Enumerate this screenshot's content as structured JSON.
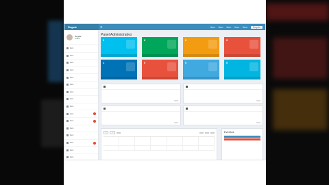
{
  "colors": {
    "topbar": "#3c8dbc",
    "aqua": "#00c0ef",
    "green": "#00a65a",
    "yellow": "#f39c12",
    "red": "#dd4b39",
    "blue": "#0073b7",
    "orange_red": "#e8523d",
    "light_blue": "#3fa9e0",
    "cyan": "#00b5e2"
  },
  "topbar": {
    "brand": "Regale",
    "menu_icon": "hamburger-icon",
    "nav": [
      "Item",
      "Item",
      "Item",
      "Item",
      "Item"
    ],
    "user": "Regale"
  },
  "sidebar": {
    "profile_name": "Regale",
    "profile_status": "Online",
    "items": [
      {
        "label": "Item",
        "badge": false
      },
      {
        "label": "Item",
        "badge": false
      },
      {
        "label": "Item",
        "badge": false
      },
      {
        "label": "Item",
        "badge": false
      },
      {
        "label": "Item",
        "badge": false
      },
      {
        "label": "Item",
        "badge": false
      },
      {
        "label": "Item",
        "badge": false
      },
      {
        "label": "Item",
        "badge": false
      },
      {
        "label": "Item",
        "badge": false
      },
      {
        "label": "Item",
        "badge": true
      },
      {
        "label": "Item",
        "badge": true
      },
      {
        "label": "Item",
        "badge": false
      },
      {
        "label": "Item",
        "badge": false
      },
      {
        "label": "Item",
        "badge": true
      },
      {
        "label": "Item",
        "badge": false
      },
      {
        "label": "Item",
        "badge": false
      }
    ]
  },
  "page": {
    "title": "Panel Administrativo",
    "subtitle": "",
    "breadcrumb": ""
  },
  "tiles": [
    {
      "num": "0",
      "label": "",
      "footer": "",
      "color": "#00c0ef"
    },
    {
      "num": "0",
      "label": "",
      "footer": "",
      "color": "#00a65a"
    },
    {
      "num": "0",
      "label": "",
      "footer": "",
      "color": "#f39c12"
    },
    {
      "num": "0",
      "label": "",
      "footer": "",
      "color": "#e8523d"
    },
    {
      "num": "1",
      "label": "",
      "footer": "",
      "color": "#0073b7"
    },
    {
      "num": "0",
      "label": "",
      "footer": "",
      "color": "#e8523d"
    },
    {
      "num": "0",
      "label": "",
      "footer": "",
      "color": "#3fa9e0"
    },
    {
      "num": "0",
      "label": "",
      "footer": "",
      "color": "#00b5e2"
    }
  ],
  "panels": [
    {
      "title": "",
      "button": ""
    },
    {
      "title": "",
      "button": ""
    },
    {
      "title": "",
      "button": ""
    },
    {
      "title": "",
      "button": ""
    }
  ],
  "calendar": {
    "prev": "<",
    "next": ">",
    "today": "",
    "title": "",
    "views": [
      "",
      "",
      ""
    ],
    "days": [
      "",
      "",
      "",
      "",
      "",
      "",
      ""
    ]
  },
  "events": {
    "title": "Eventos",
    "bars": [
      "#3c8dbc",
      "#dd4b39"
    ]
  }
}
